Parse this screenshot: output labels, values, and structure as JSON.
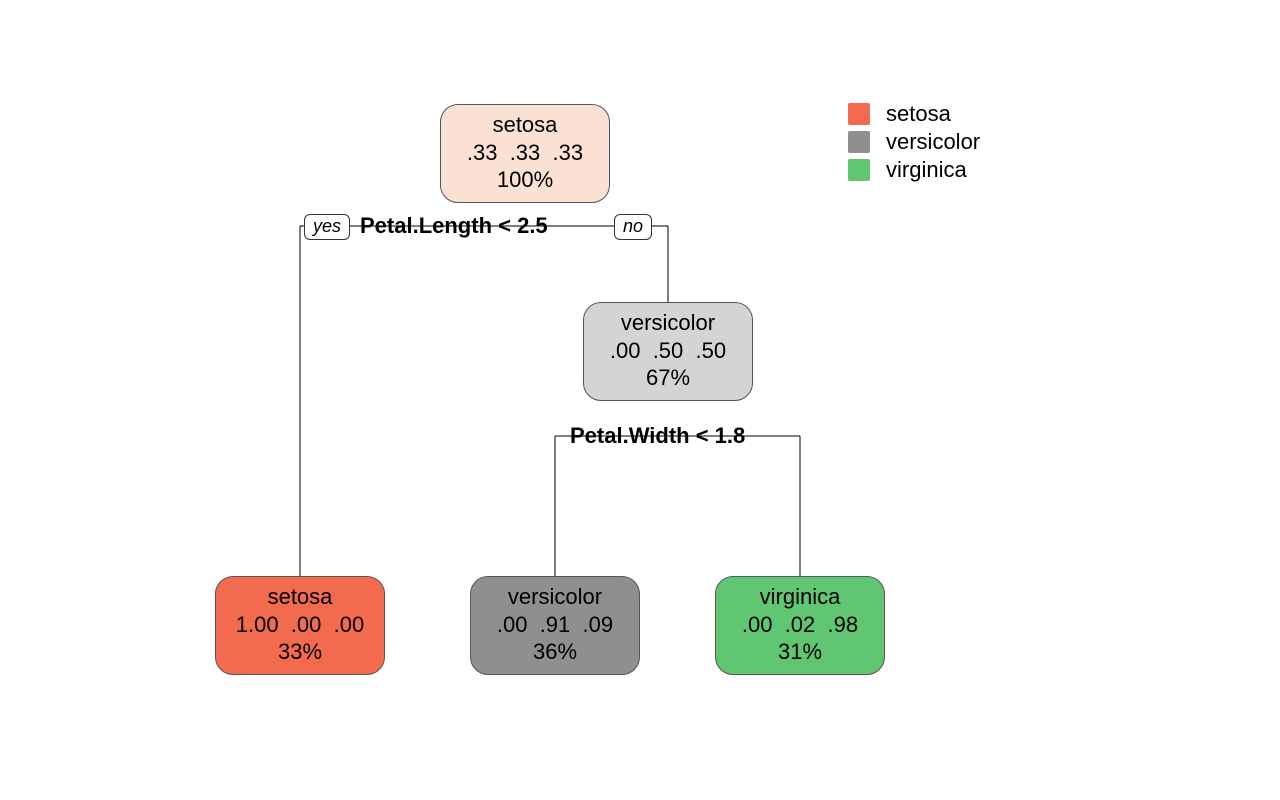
{
  "legend": {
    "items": [
      {
        "label": "setosa",
        "color": "#f36b4f"
      },
      {
        "label": "versicolor",
        "color": "#8f8f8f"
      },
      {
        "label": "virginica",
        "color": "#60c671"
      }
    ]
  },
  "tree": {
    "nodes": {
      "root": {
        "class_label": "setosa",
        "probs": ".33  .33  .33",
        "percent": "100%",
        "fill": "#fbe0d4"
      },
      "vers_internal": {
        "class_label": "versicolor",
        "probs": ".00  .50  .50",
        "percent": "67%",
        "fill": "#d4d4d4"
      },
      "leaf_setosa": {
        "class_label": "setosa",
        "probs": "1.00  .00  .00",
        "percent": "33%",
        "fill": "#f36b4f"
      },
      "leaf_versicolor": {
        "class_label": "versicolor",
        "probs": ".00  .91  .09",
        "percent": "36%",
        "fill": "#8f8f8f"
      },
      "leaf_virginica": {
        "class_label": "virginica",
        "probs": ".00  .02  .98",
        "percent": "31%",
        "fill": "#60c671"
      }
    },
    "splits": {
      "s1": {
        "condition": "Petal.Length < 2.5",
        "yes_label": "yes",
        "no_label": "no"
      },
      "s2": {
        "condition": "Petal.Width < 1.8"
      }
    }
  }
}
